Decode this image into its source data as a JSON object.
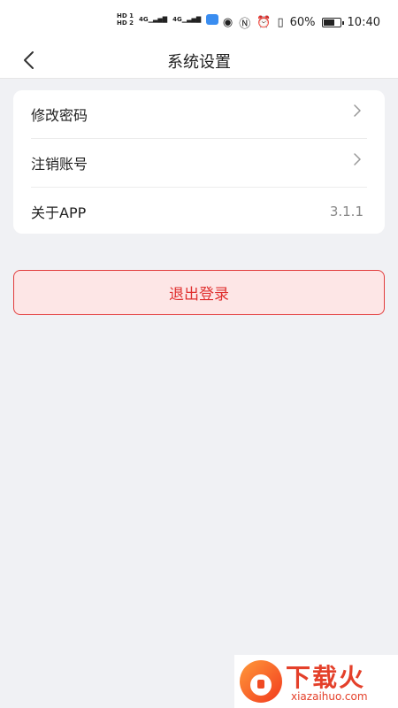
{
  "status_bar": {
    "sim1": "HD 1",
    "sim2": "HD 2",
    "net1": "4G",
    "net2": "4G",
    "battery": "60%",
    "time": "10:40"
  },
  "nav": {
    "title": "系统设置",
    "back_icon": "chevron-left-icon"
  },
  "settings": {
    "items": [
      {
        "label": "修改密码",
        "icon": "chevron-right-icon"
      },
      {
        "label": "注销账号",
        "icon": "chevron-right-icon"
      },
      {
        "label": "关于APP",
        "value": "3.1.1"
      }
    ]
  },
  "logout": {
    "label": "退出登录"
  },
  "watermark": {
    "title": "下载火",
    "url": "xiazaihuo.com"
  },
  "colors": {
    "accent_red": "#e0302f",
    "logout_bg": "#fde6e6",
    "page_bg": "#f0f1f4"
  }
}
